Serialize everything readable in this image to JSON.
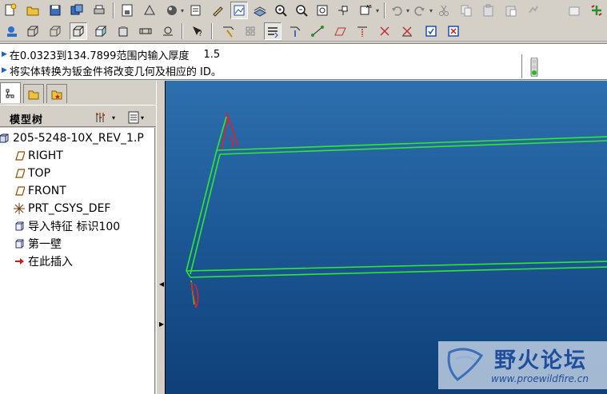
{
  "toolbar_top": {
    "icons": [
      "new-file-icon",
      "open-folder-icon",
      "save-icon",
      "save-copy-icon",
      "print-icon",
      "model-display-icon",
      "shading-icon",
      "render-icon",
      "appearance-icon",
      "spin-center-icon",
      "zoom-in-icon",
      "zoom-out-icon",
      "refit-icon",
      "reorient-icon",
      "saved-views-icon",
      "undo-icon",
      "redo-icon",
      "cut-icon",
      "copy-icon",
      "paste-icon",
      "paste-special-icon",
      "regenerate-icon"
    ],
    "redo_badge": "AB"
  },
  "toolbar_bottom": {
    "icons": [
      "info-icon",
      "wireframe-icon",
      "hidden-line-icon",
      "no-hidden-icon",
      "shaded-icon",
      "datum-planes-icon",
      "datum-axes-icon",
      "datum-points-icon",
      "csys-icon",
      "whats-this-icon",
      "sketch-tool-icon",
      "layers-icon",
      "extrude-icon",
      "flat-wall-icon",
      "edge-rip-icon",
      "surface-rip-icon",
      "rip-connect-icon",
      "accept-icon",
      "cancel-icon"
    ]
  },
  "message_area": {
    "line1_prompt": "在0.0323到134.7899范围内输入厚度",
    "line1_value": "1.5",
    "line2": "将实体转换为钣金件将改变几何及相应的 ID。"
  },
  "panel": {
    "tabs": [
      "model-tree-tab",
      "folder-browser-tab",
      "favorites-tab"
    ],
    "title": "模型树",
    "tree": [
      {
        "label": "205-5248-10X_REV_1.P",
        "icon": "part-icon"
      },
      {
        "label": "RIGHT",
        "icon": "datum-plane-icon"
      },
      {
        "label": "TOP",
        "icon": "datum-plane-icon"
      },
      {
        "label": "FRONT",
        "icon": "datum-plane-icon"
      },
      {
        "label": "PRT_CSYS_DEF",
        "icon": "csys-icon"
      },
      {
        "label": "导入特征 标识100",
        "icon": "feature-icon"
      },
      {
        "label": "第一壁",
        "icon": "feature-icon"
      },
      {
        "label": "在此插入",
        "icon": "insert-here-arrow-icon"
      }
    ]
  },
  "colors": {
    "viewport_top": "#2e6fae",
    "viewport_bottom": "#0f3f78",
    "edge_green": "#2fe82f",
    "edge_red": "#e0202a"
  },
  "watermark": {
    "title": "野火论坛",
    "url": "www.proewildfire.cn"
  }
}
